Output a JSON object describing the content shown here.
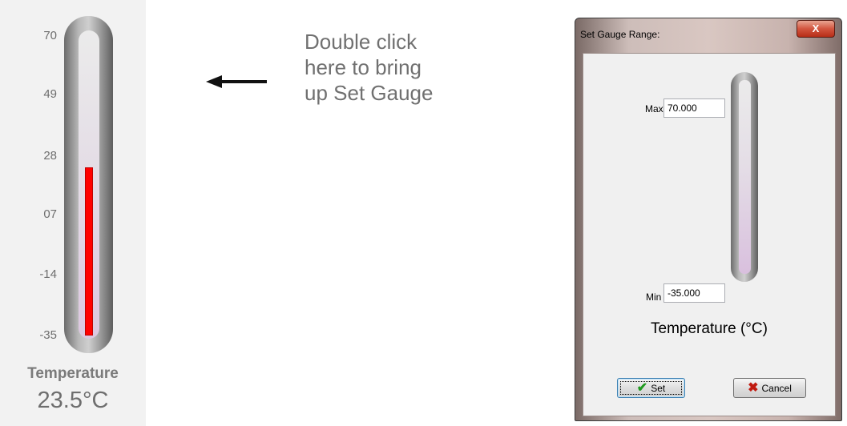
{
  "widget": {
    "ticks": [
      "70",
      "49",
      "28",
      "07",
      "-14",
      "-35"
    ],
    "scale_min": -35,
    "scale_max": 70,
    "fill_value": 23.5,
    "fill_color": "#ff0000",
    "title": "Temperature",
    "value_display": "23.5°C"
  },
  "annotation": {
    "text": "Double click\nhere to bring\nup Set Gauge",
    "arrow_icon": "arrow-left-icon"
  },
  "dialog": {
    "title": "Set Gauge Range:",
    "close_label": "X",
    "max_label": "Max",
    "max_value": "70.000",
    "min_label": "Min",
    "min_value": "-35.000",
    "gauge_title": "Temperature (°C)",
    "set_label": "Set",
    "cancel_label": "Cancel",
    "set_icon": "check-icon",
    "cancel_icon": "x-icon"
  }
}
